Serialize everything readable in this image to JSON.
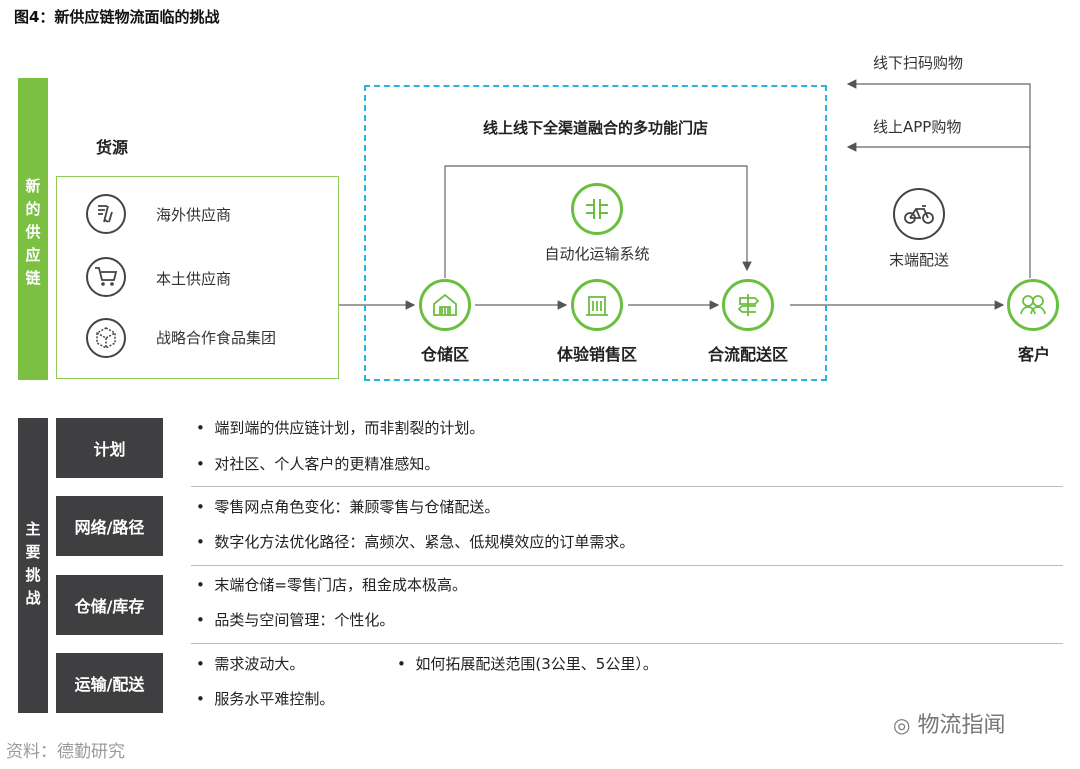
{
  "title": "图4：新供应链物流面临的挑战",
  "supply_chain_label": [
    "新",
    "的",
    "供",
    "应",
    "链"
  ],
  "sources": {
    "title": "货源",
    "items": [
      {
        "icon": "overseas-supplier-icon",
        "label": "海外供应商"
      },
      {
        "icon": "shopping-cart-icon",
        "label": "本土供应商"
      },
      {
        "icon": "package-box-icon",
        "label": "战略合作食品集团"
      }
    ]
  },
  "store": {
    "title": "线上线下全渠道融合的多功能门店",
    "automation": "自动化运输系统",
    "nodes": {
      "warehouse": "仓储区",
      "experience": "体验销售区",
      "distribution": "合流配送区"
    }
  },
  "customer": {
    "label": "客户",
    "last_mile": "末端配送",
    "offline_shopping": "线下扫码购物",
    "online_shopping": "线上APP购物"
  },
  "challenges_label": [
    "主",
    "要",
    "挑",
    "战"
  ],
  "challenges": [
    {
      "category": "计划",
      "bullets": [
        "端到端的供应链计划，而非割裂的计划。",
        "对社区、个人客户的更精准感知。"
      ]
    },
    {
      "category": "网络/路径",
      "bullets": [
        "零售网点角色变化：兼顾零售与仓储配送。",
        "数字化方法优化路径：高频次、紧急、低规模效应的订单需求。"
      ]
    },
    {
      "category": "仓储/库存",
      "bullets": [
        "末端仓储=零售门店，租金成本极高。",
        "品类与空间管理：个性化。"
      ]
    },
    {
      "category": "运输/配送",
      "bullets": [
        "需求波动大。",
        "服务水平难控制。"
      ],
      "extra_bullet": "如何拓展配送范围(3公里、5公里）。"
    }
  ],
  "footer": "资料：德勤研究",
  "watermark": "物流指闻",
  "colors": {
    "green": "#7bc043",
    "dark": "#3f3f41",
    "dashed": "#2ab3e0"
  }
}
